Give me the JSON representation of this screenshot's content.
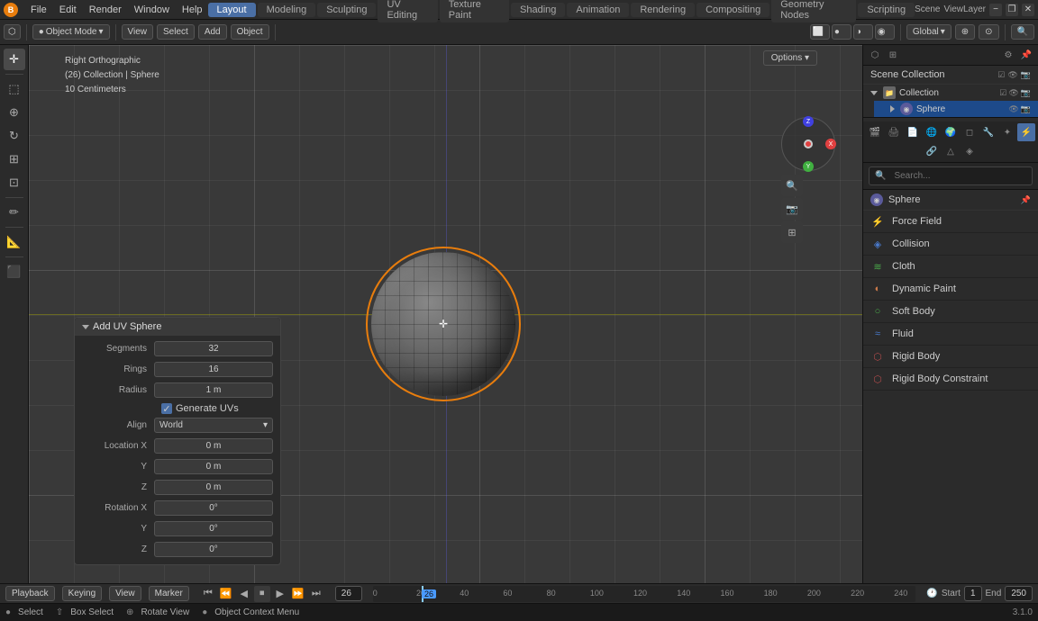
{
  "app": {
    "title": "Blender",
    "version": "3.1.0"
  },
  "top_menu": {
    "logo": "B",
    "items": [
      "File",
      "Edit",
      "Render",
      "Window",
      "Help"
    ],
    "tabs": [
      "Layout",
      "Modeling",
      "Sculpting",
      "UV Editing",
      "Texture Paint",
      "Shading",
      "Animation",
      "Rendering",
      "Compositing",
      "Geometry Nodes",
      "Scripting"
    ],
    "active_tab": "Layout",
    "scene_label": "Scene",
    "viewlayer_label": "ViewLayer",
    "win_minimize": "−",
    "win_restore": "❐",
    "win_close": "✕"
  },
  "viewport_toolbar": {
    "object_mode": "Object Mode",
    "view_label": "View",
    "select_label": "Select",
    "add_label": "Add",
    "object_label": "Object",
    "global_label": "Global",
    "options_label": "Options ▾"
  },
  "viewport": {
    "view_info_line1": "Right Orthographic",
    "view_info_line2": "(26) Collection | Sphere",
    "view_info_line3": "10 Centimeters",
    "gizmo_x": "X",
    "gizmo_y": "Y",
    "gizmo_z": "Z"
  },
  "add_uv_sphere_panel": {
    "title": "Add UV Sphere",
    "segments_label": "Segments",
    "segments_value": "32",
    "rings_label": "Rings",
    "rings_value": "16",
    "radius_label": "Radius",
    "radius_value": "1 m",
    "generate_uvs_label": "Generate UVs",
    "align_label": "Align",
    "align_value": "World",
    "location_x_label": "Location X",
    "location_x_value": "0 m",
    "location_y_label": "Y",
    "location_y_value": "0 m",
    "location_z_label": "Z",
    "location_z_value": "0 m",
    "rotation_x_label": "Rotation X",
    "rotation_x_value": "0°",
    "rotation_y_label": "Y",
    "rotation_y_value": "0°",
    "rotation_z_label": "Z",
    "rotation_z_value": "0°"
  },
  "scene_collection": {
    "title": "Scene Collection",
    "items": [
      {
        "label": "Collection",
        "indent": 1,
        "icon": "folder"
      },
      {
        "label": "Sphere",
        "indent": 2,
        "icon": "sphere",
        "active": true
      }
    ]
  },
  "physics_panel": {
    "object_name": "Sphere",
    "items": [
      {
        "label": "Force Field",
        "icon": "⚡",
        "color": "blue"
      },
      {
        "label": "Collision",
        "icon": "◈",
        "color": "blue"
      },
      {
        "label": "Cloth",
        "icon": "≋",
        "color": "green"
      },
      {
        "label": "Dynamic Paint",
        "icon": "◐",
        "color": "orange"
      },
      {
        "label": "Soft Body",
        "icon": "○",
        "color": "green"
      },
      {
        "label": "Fluid",
        "icon": "≈",
        "color": "blue"
      },
      {
        "label": "Rigid Body",
        "icon": "⬡",
        "color": "red"
      },
      {
        "label": "Rigid Body Constraint",
        "icon": "⬡",
        "color": "red"
      }
    ]
  },
  "timeline": {
    "frame_current": "26",
    "frame_start_label": "Start",
    "frame_start": "1",
    "frame_end_label": "End",
    "frame_end": "250",
    "playback_label": "Playback",
    "keying_label": "Keying",
    "view_label": "View",
    "marker_label": "Marker"
  },
  "status_bar": {
    "select_label": "Select",
    "box_select_label": "Box Select",
    "rotate_view_label": "Rotate View",
    "context_menu_label": "Object Context Menu",
    "version": "3.1.0"
  }
}
